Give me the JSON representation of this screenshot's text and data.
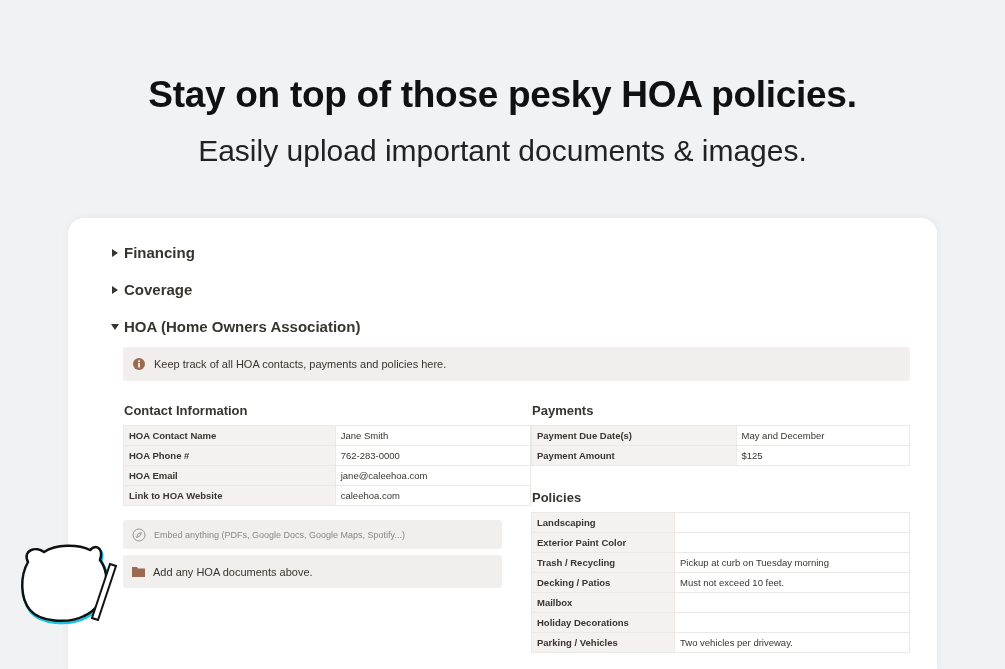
{
  "headline": "Stay on top of those pesky HOA policies.",
  "subheadline": "Easily upload important documents & images.",
  "toggles": [
    {
      "label": "Financing",
      "expanded": false
    },
    {
      "label": "Coverage",
      "expanded": false
    },
    {
      "label": "HOA (Home Owners Association)",
      "expanded": true
    }
  ],
  "callout": {
    "text": "Keep track of all HOA contacts, payments and policies here."
  },
  "contact": {
    "title": "Contact Information",
    "rows": [
      {
        "label": "HOA Contact Name",
        "value": "Jane Smith"
      },
      {
        "label": "HOA Phone #",
        "value": "762-283-0000"
      },
      {
        "label": "HOA Email",
        "value": "jane@caleehoa.com"
      },
      {
        "label": "Link to HOA Website",
        "value": "caleehoa.com"
      }
    ]
  },
  "embed": {
    "placeholder": "Embed anything (PDFs, Google Docs, Google Maps, Spotify...)"
  },
  "documents": {
    "text": "Add any HOA documents above."
  },
  "payments": {
    "title": "Payments",
    "rows": [
      {
        "label": "Payment Due Date(s)",
        "value": "May and December"
      },
      {
        "label": "Payment Amount",
        "value": "$125"
      }
    ]
  },
  "policies": {
    "title": "Policies",
    "rows": [
      {
        "label": "Landscaping"
      },
      {
        "label": "Exterior Paint Color"
      },
      {
        "label": "Trash / Recycling",
        "value": "Pickup at curb on Tuesday morning"
      },
      {
        "label": "Decking / Patios",
        "value": "Must not exceed 10 feet."
      },
      {
        "label": "Mailbox"
      },
      {
        "label": "Holiday Decorations"
      },
      {
        "label": "Parking / Vehicles",
        "value": "Two vehicles per driveway."
      }
    ]
  }
}
